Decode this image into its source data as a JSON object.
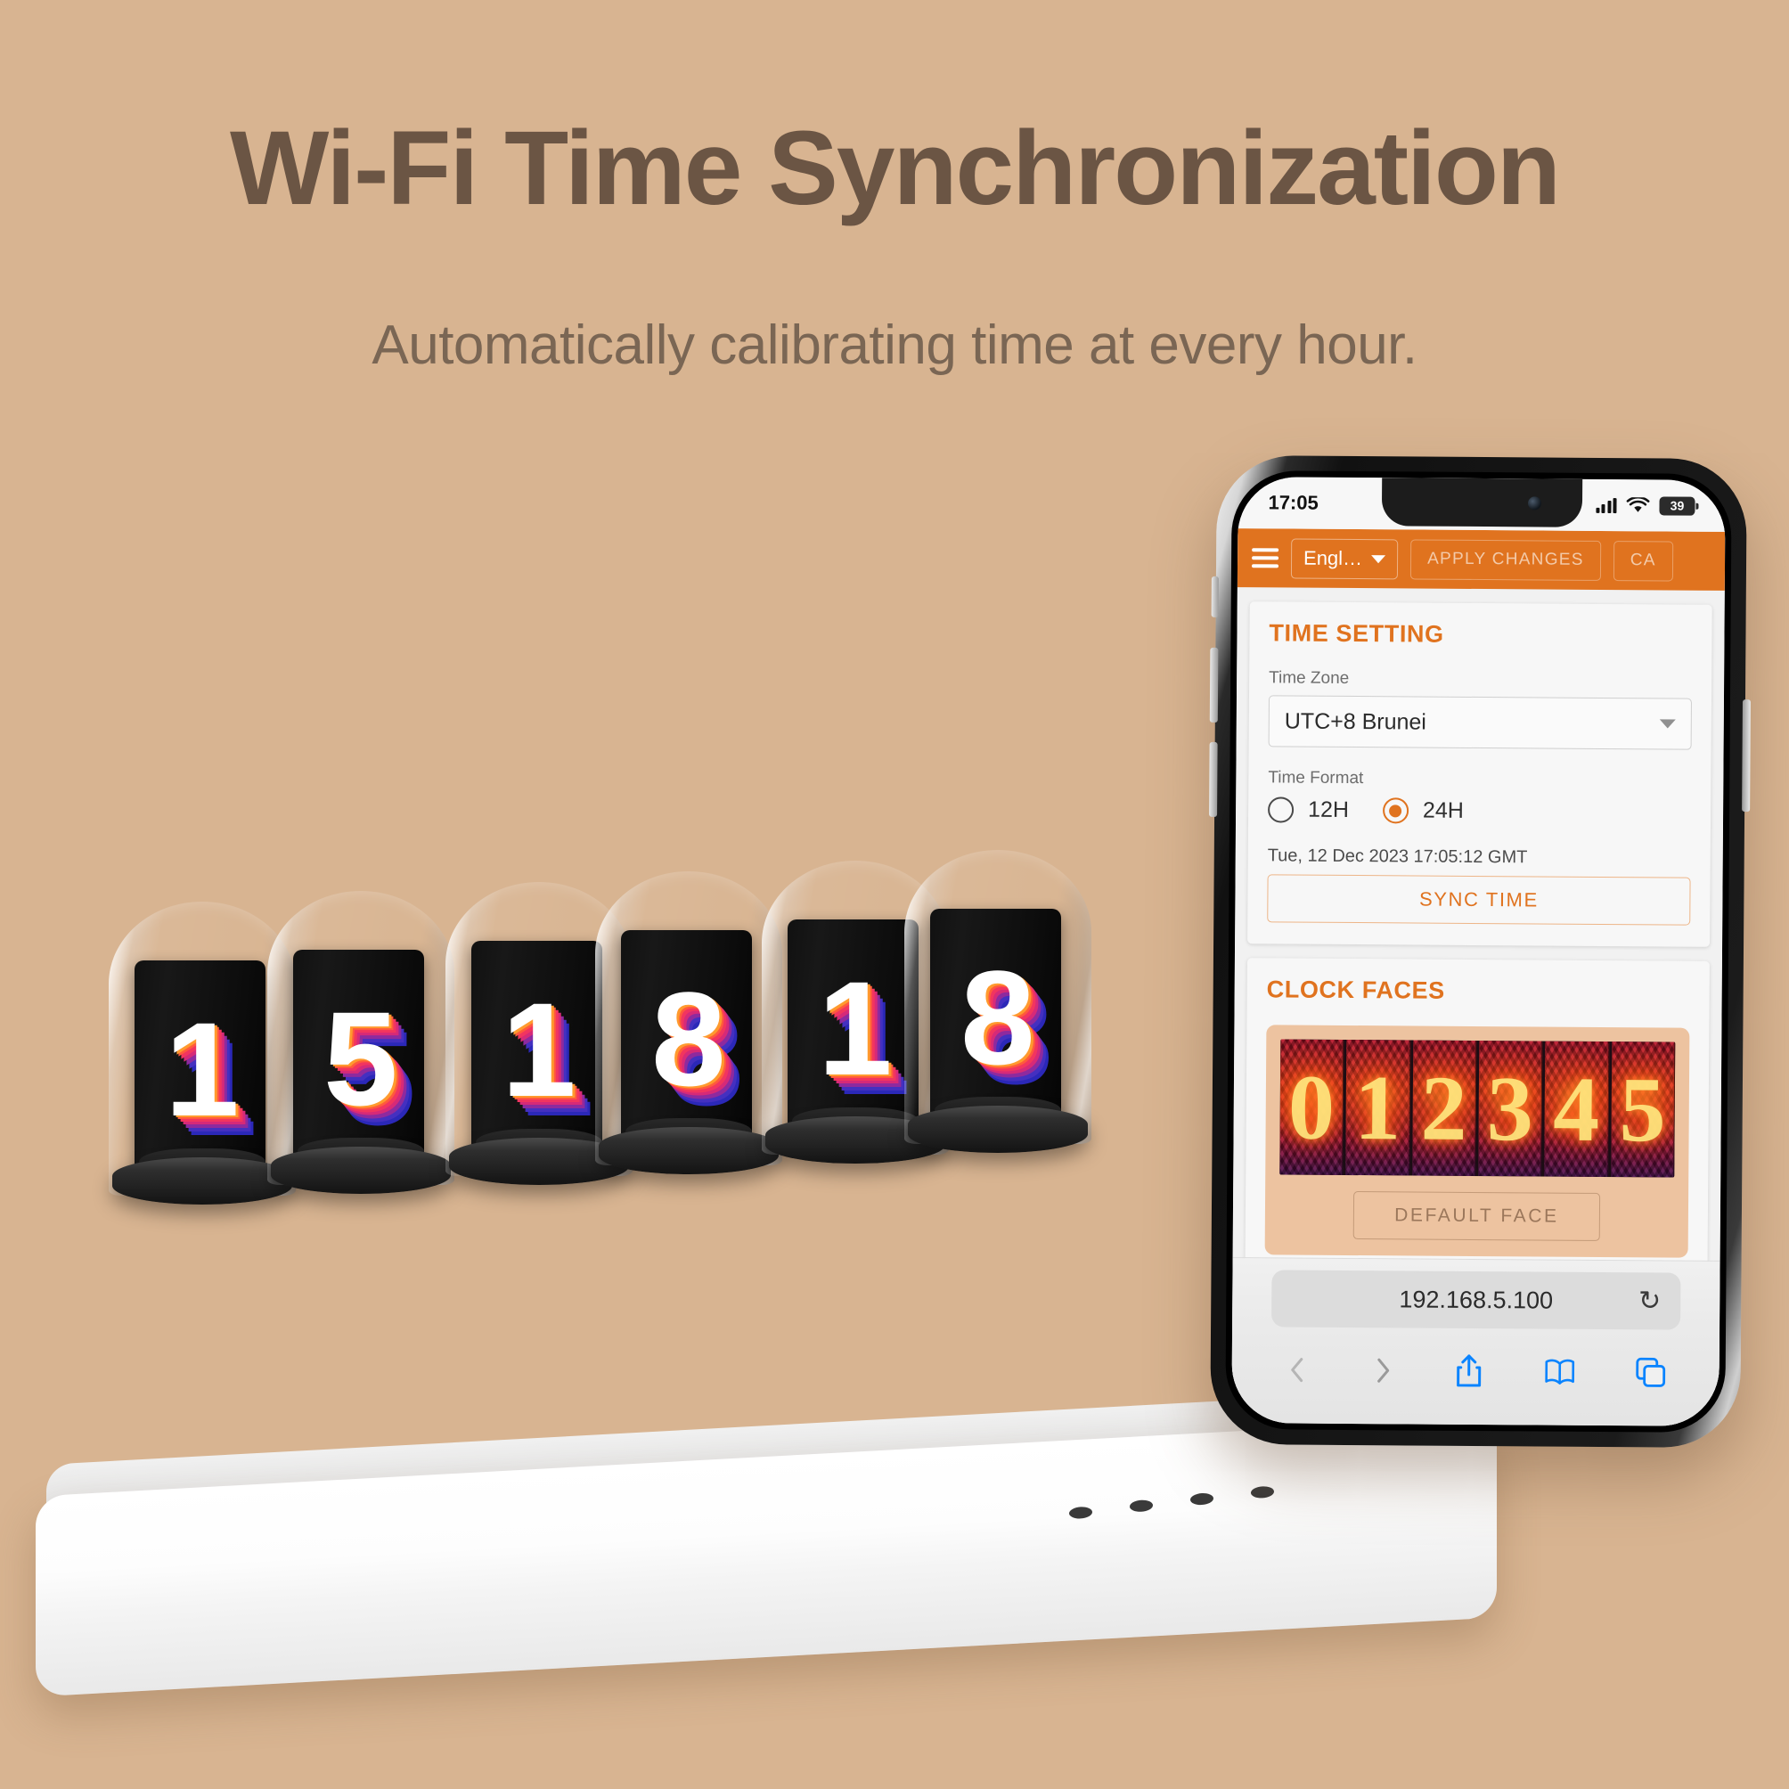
{
  "hero": {
    "title": "Wi-Fi Time Synchronization",
    "subtitle": "Automatically calibrating time at every hour.",
    "title_color": "#6b5544",
    "background_color": "#d8b491"
  },
  "clock": {
    "digits": [
      "1",
      "5",
      "1",
      "8",
      "1",
      "8"
    ],
    "time_display": "151818"
  },
  "phone": {
    "status_bar": {
      "time": "17:05",
      "signal_icon": "cellular-signal-icon",
      "wifi_icon": "wifi-icon",
      "battery_level": "39"
    },
    "app_bar": {
      "menu_icon": "hamburger-menu-icon",
      "language": "Engl…",
      "language_caret_icon": "chevron-down-icon",
      "apply_label": "APPLY CHANGES",
      "cancel_label": "CA",
      "accent_color": "#e0731f"
    },
    "time_setting": {
      "heading": "TIME SETTING",
      "timezone_label": "Time Zone",
      "timezone_value": "UTC+8 Brunei",
      "timezone_caret_icon": "chevron-down-icon",
      "format_label": "Time Format",
      "format_options": [
        {
          "label": "12H",
          "selected": false
        },
        {
          "label": "24H",
          "selected": true
        }
      ],
      "timestamp": "Tue, 12 Dec 2023 17:05:12 GMT",
      "sync_label": "SYNC TIME"
    },
    "clock_faces": {
      "heading": "CLOCK FACES",
      "preview_digits": [
        "0",
        "1",
        "2",
        "3",
        "4",
        "5"
      ],
      "default_face_label": "DEFAULT FACE"
    },
    "browser": {
      "url": "192.168.5.100",
      "reload_icon": "reload-icon",
      "back_icon": "chevron-left-icon",
      "forward_icon": "chevron-right-icon",
      "share_icon": "share-icon",
      "bookmarks_icon": "book-icon",
      "tabs_icon": "tabs-icon"
    }
  }
}
